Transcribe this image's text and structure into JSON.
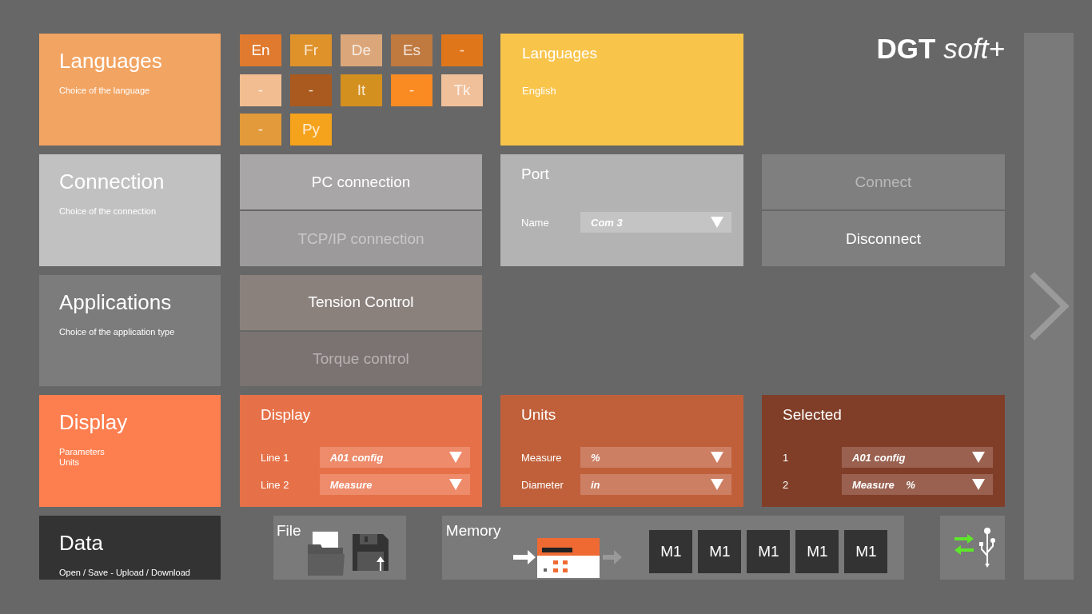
{
  "brand": {
    "name": "DGT",
    "suffix": "soft+"
  },
  "sections": [
    {
      "title": "Languages",
      "description": [
        "Choice of the language"
      ]
    },
    {
      "title": "Connection",
      "description": [
        "Choice of the connection"
      ]
    },
    {
      "title": "Applications",
      "description": [
        "Choice of the application type"
      ]
    },
    {
      "title": "Display",
      "description": [
        "Parameters",
        "Units"
      ]
    },
    {
      "title": "Data",
      "description": [
        "Open / Save - Upload / Download"
      ]
    }
  ],
  "language_tiles": [
    {
      "label": "En",
      "color": "#e07a2e",
      "selected": true
    },
    {
      "label": "Fr",
      "color": "#e0922a",
      "selected": false
    },
    {
      "label": "De",
      "color": "#dba77a",
      "selected": false
    },
    {
      "label": "Es",
      "color": "#c07a40",
      "selected": false
    },
    {
      "label": "-",
      "color": "#e0761a",
      "selected": false
    },
    {
      "label": "-",
      "color": "#f2bd90",
      "selected": false
    },
    {
      "label": "-",
      "color": "#aa5a1e",
      "selected": false
    },
    {
      "label": "It",
      "color": "#d4901f",
      "selected": false
    },
    {
      "label": "-",
      "color": "#fa8a22",
      "selected": false
    },
    {
      "label": "Tk",
      "color": "#f0c09a",
      "selected": false
    },
    {
      "label": "-",
      "color": "#e29a3a",
      "selected": false
    },
    {
      "label": "Py",
      "color": "#f5a21c",
      "selected": false
    }
  ],
  "language_info": {
    "title": "Languages",
    "value": "English"
  },
  "connection_options": [
    {
      "label": "PC connection",
      "selected": true
    },
    {
      "label": "TCP/IP connection",
      "selected": false
    }
  ],
  "port": {
    "title": "Port",
    "fields": [
      {
        "label": "Name",
        "value": "Com 3"
      }
    ]
  },
  "connection_buttons": [
    {
      "label": "Connect",
      "disabled": true
    },
    {
      "label": "Disconnect",
      "disabled": false
    }
  ],
  "application_options": [
    {
      "label": "Tension Control",
      "selected": true
    },
    {
      "label": "Torque control",
      "selected": false
    }
  ],
  "display_panels": [
    {
      "title": "Display",
      "fields": [
        {
          "label": "Line 1",
          "value": "A01 config"
        },
        {
          "label": "Line 2",
          "value": "Measure"
        }
      ]
    },
    {
      "title": "Units",
      "fields": [
        {
          "label": "Measure",
          "value": "%"
        },
        {
          "label": "Diameter",
          "value": "in"
        }
      ]
    },
    {
      "title": "Selected",
      "fields": [
        {
          "label": "1",
          "value": "A01 config"
        },
        {
          "label": "2",
          "value": "Measure    %"
        }
      ]
    }
  ],
  "file": {
    "title": "File"
  },
  "memory": {
    "title": "Memory",
    "slots": [
      "M1",
      "M1",
      "M1",
      "M1",
      "M1"
    ]
  }
}
